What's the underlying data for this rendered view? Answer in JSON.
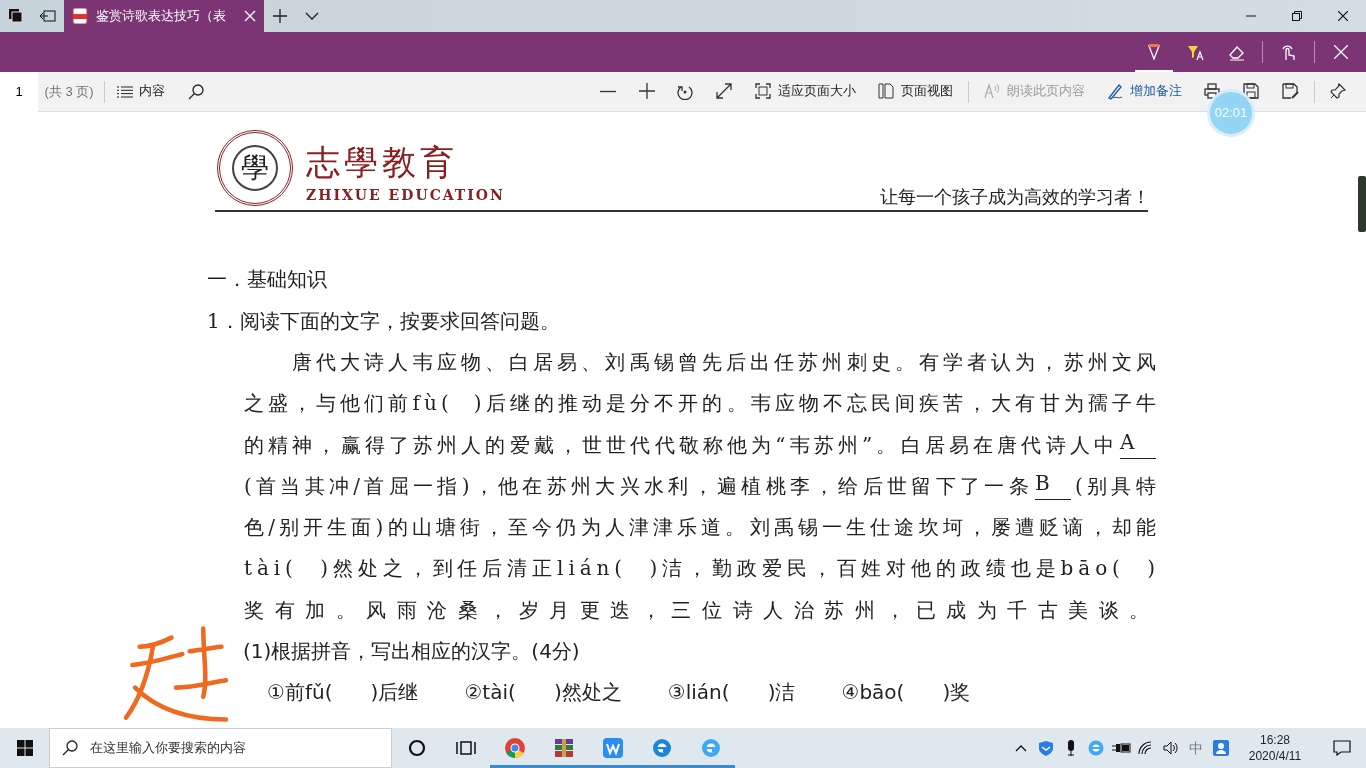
{
  "window": {
    "tab": {
      "title": "鉴赏诗歌表达技巧（表",
      "selected": true
    }
  },
  "ink_tools": [
    {
      "kind": "pen",
      "selected": true
    },
    {
      "kind": "highlighter",
      "selected": false
    },
    {
      "kind": "eraser",
      "selected": false
    },
    {
      "kind": "touch",
      "selected": false
    }
  ],
  "toolbar": {
    "page_number": "1",
    "page_count": "(共 3 页)",
    "contents": "内容",
    "tools": [
      {
        "kind": "zoomout"
      },
      {
        "kind": "zoomin"
      },
      {
        "kind": "rotate"
      },
      {
        "kind": "fullscreen"
      },
      {
        "kind": "fit",
        "label": "适应页面大小"
      },
      {
        "kind": "pageview",
        "label": "页面视图"
      },
      {
        "kind": "read",
        "label": "朗读此页内容",
        "disabled": true
      },
      {
        "kind": "note",
        "label": "增加备注",
        "disabled": false
      },
      {
        "kind": "print"
      },
      {
        "kind": "save"
      },
      {
        "kind": "saveas"
      },
      {
        "kind": "pin"
      }
    ]
  },
  "timer": "02:01",
  "document": {
    "logo_char": "學",
    "brand": "志學教育",
    "brand_en": "ZHIXUE EDUCATION",
    "slogan": "让每一个孩子成为高效的学习者！",
    "section": "一．基础知识",
    "question": "1．阅读下面的文字，按要求回答问题。",
    "paragraph": [
      [
        {
          "kind": "text",
          "text": "唐代大诗人韦应物、白居易、刘禹锡曾先后出任苏州刺史。有学者认为，苏州文风"
        }
      ],
      [
        {
          "kind": "text",
          "text": "之盛，与他们前fù(  )后继的推动是分不开的。韦应物不忘民间疾苦，大有甘为孺子牛"
        }
      ],
      [
        {
          "kind": "text",
          "text": "的精神，赢得了苏州人的爱戴，世世代代敬称他为“韦苏州”。白居易在唐代诗人中"
        },
        {
          "kind": "blank",
          "text": "A"
        }
      ],
      [
        {
          "kind": "text",
          "text": "(首当其冲/首屈一指)，他在苏州大兴水利，遍植桃李，给后世留下了一条"
        },
        {
          "kind": "blank",
          "text": "B"
        },
        {
          "kind": "text",
          "text": "(别具特"
        }
      ],
      [
        {
          "kind": "text",
          "text": "色/别开生面)的山塘街，至今仍为人津津乐道。刘禹锡一生仕途坎坷，屡遭贬谪，却能"
        }
      ],
      [
        {
          "kind": "text",
          "text": "tài(  )然处之，到任后清正lián(  )洁，勤政爱民，百姓对他的政绩也是bāo(  )"
        }
      ],
      [
        {
          "kind": "text",
          "text": "奖有加。风雨沧桑，岁月更迭，三位诗人治苏州，已成为千古美谈。"
        }
      ]
    ],
    "subquestion": "(1)根据拼音，写出相应的汉字。(4分)",
    "items": [
      "①前fǔ(      )后继",
      "②tài(      )然处之",
      "③lián(      )洁",
      "④bāo(      )奖"
    ]
  },
  "taskbar": {
    "search_placeholder": "在这里输入你要搜索的内容",
    "apps": [
      {
        "kind": "cortana",
        "running": false
      },
      {
        "kind": "taskview",
        "running": false
      },
      {
        "kind": "chrome",
        "running": true
      },
      {
        "kind": "winrar",
        "running": true
      },
      {
        "kind": "wps",
        "running": true
      },
      {
        "kind": "edge",
        "running": true
      },
      {
        "kind": "ie",
        "running": true
      }
    ],
    "ime": "中",
    "time": "16:28",
    "date": "2020/4/11"
  }
}
